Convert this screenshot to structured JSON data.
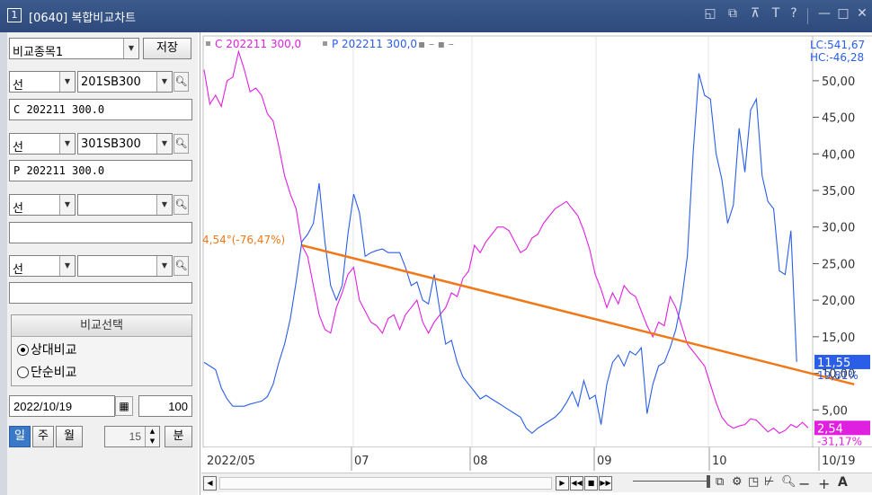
{
  "window": {
    "number": "1",
    "title": "[0640] 복합비교차트",
    "controls": [
      "◱",
      "⧉",
      "⊼",
      "T",
      "?",
      "—",
      "□",
      "✕"
    ]
  },
  "left_panel": {
    "compare_select": {
      "value": "비교종목1"
    },
    "save_button": "저장",
    "rows": [
      {
        "type": "선",
        "code": "201SB300",
        "name": "C 202211 300.0"
      },
      {
        "type": "선",
        "code": "301SB300",
        "name": "P 202211 300.0"
      },
      {
        "type": "선",
        "code": "",
        "name": ""
      },
      {
        "type": "선",
        "code": "",
        "name": ""
      }
    ],
    "compare_group": {
      "title": "비교선택",
      "options": [
        {
          "label": "상대비교",
          "selected": true
        },
        {
          "label": "단순비교",
          "selected": false
        }
      ]
    },
    "date": "2022/10/19",
    "count": "100",
    "periods": [
      {
        "label": "일",
        "active": true
      },
      {
        "label": "주",
        "active": false
      },
      {
        "label": "월",
        "active": false
      }
    ],
    "minute_value": "15",
    "minute_button": "분"
  },
  "chart_data": {
    "type": "line",
    "legend": [
      {
        "name": "C 202211 300,0",
        "color": "#e020e0"
      },
      {
        "name": "P 202211 300,0",
        "color": "#2a5ee8"
      }
    ],
    "y_ticks": [
      "50,00",
      "45,00",
      "40,00",
      "35,00",
      "30,00",
      "25,00",
      "20,00",
      "15,00",
      "10,00",
      "5,00"
    ],
    "ylim": [
      0,
      56
    ],
    "x_labels": [
      "2022/05",
      "07",
      "08",
      "09",
      "10",
      "10/19"
    ],
    "header_labels": {
      "lc": "LC:541,67",
      "hc": "HC:-46,28"
    },
    "trendline_label": "4,54°(-76,47%)",
    "price_tags": [
      {
        "value": "11,55",
        "color": "#2a5ee8",
        "pct": "19,81%"
      },
      {
        "value": "2,54",
        "color": "#e020e0",
        "pct": "-31,17%"
      }
    ],
    "series": [
      {
        "name": "C 202211 300,0",
        "color": "#e020e0",
        "values": [
          51.5,
          46.8,
          48.0,
          46.5,
          50.0,
          50.5,
          54.0,
          51.5,
          48.5,
          49.0,
          48.0,
          45.5,
          44.5,
          41.0,
          37.0,
          34.5,
          32.5,
          27.5,
          26.0,
          22.0,
          18.0,
          16.0,
          15.5,
          19.0,
          21.0,
          23.5,
          24.5,
          20.0,
          18.5,
          17.0,
          16.5,
          15.5,
          17.5,
          18.0,
          16.0,
          18.0,
          19.0,
          20.0,
          17.0,
          15.5,
          17.0,
          18.0,
          19.0,
          21.0,
          20.5,
          23.0,
          24.0,
          27.5,
          26.5,
          28.0,
          29.0,
          30.0,
          30.0,
          29.5,
          28.0,
          26.5,
          27.0,
          28.5,
          29.0,
          30.5,
          31.5,
          32.5,
          33.0,
          33.5,
          32.5,
          31.5,
          29.5,
          27.0,
          23.5,
          21.5,
          19.0,
          21.0,
          19.5,
          22.0,
          21.0,
          20.5,
          18.5,
          16.5,
          15.0,
          17.0,
          16.5,
          20.5,
          19.0,
          16.5,
          14.0,
          13.0,
          12.0,
          11.0,
          8.5,
          6.0,
          4.0,
          3.0,
          2.5,
          2.8,
          3.0,
          3.8,
          3.6,
          2.8,
          2.0,
          2.5,
          1.8,
          2.2,
          3.0,
          2.6,
          3.3,
          2.54
        ]
      },
      {
        "name": "P 202211 300,0",
        "color": "#2a5ee8",
        "values": [
          11.5,
          11.0,
          10.5,
          8.0,
          6.5,
          5.5,
          5.5,
          5.5,
          5.8,
          6.0,
          6.2,
          6.8,
          8.5,
          11.5,
          14.0,
          17.5,
          22.5,
          28.0,
          29.0,
          30.5,
          36.0,
          28.0,
          22.0,
          20.0,
          22.0,
          29.0,
          34.5,
          32.0,
          26.0,
          26.5,
          26.8,
          27.0,
          26.5,
          26.5,
          26.5,
          24.5,
          22.0,
          22.5,
          20.0,
          19.5,
          23.5,
          18.5,
          14.0,
          14.5,
          11.5,
          9.5,
          8.5,
          7.5,
          6.5,
          7.0,
          6.5,
          6.0,
          5.5,
          5.0,
          4.5,
          4.0,
          2.5,
          1.8,
          2.5,
          3.0,
          3.5,
          4.0,
          4.8,
          6.0,
          7.5,
          5.5,
          9.0,
          6.5,
          7.0,
          3.0,
          8.5,
          11.5,
          12.5,
          11.0,
          13.0,
          12.5,
          13.5,
          4.5,
          8.5,
          11.0,
          11.5,
          13.5,
          16.0,
          20.0,
          26.0,
          40.0,
          51.0,
          48.0,
          47.5,
          40.0,
          36.5,
          30.5,
          33.0,
          43.5,
          37.5,
          46.0,
          47.5,
          37.0,
          33.5,
          32.5,
          24.0,
          23.5,
          29.5,
          11.55
        ]
      }
    ],
    "trendline": {
      "color": "#f07818",
      "start": {
        "index": 17,
        "value": 27.5
      },
      "end": {
        "index": 113,
        "value": 8.5
      }
    }
  }
}
